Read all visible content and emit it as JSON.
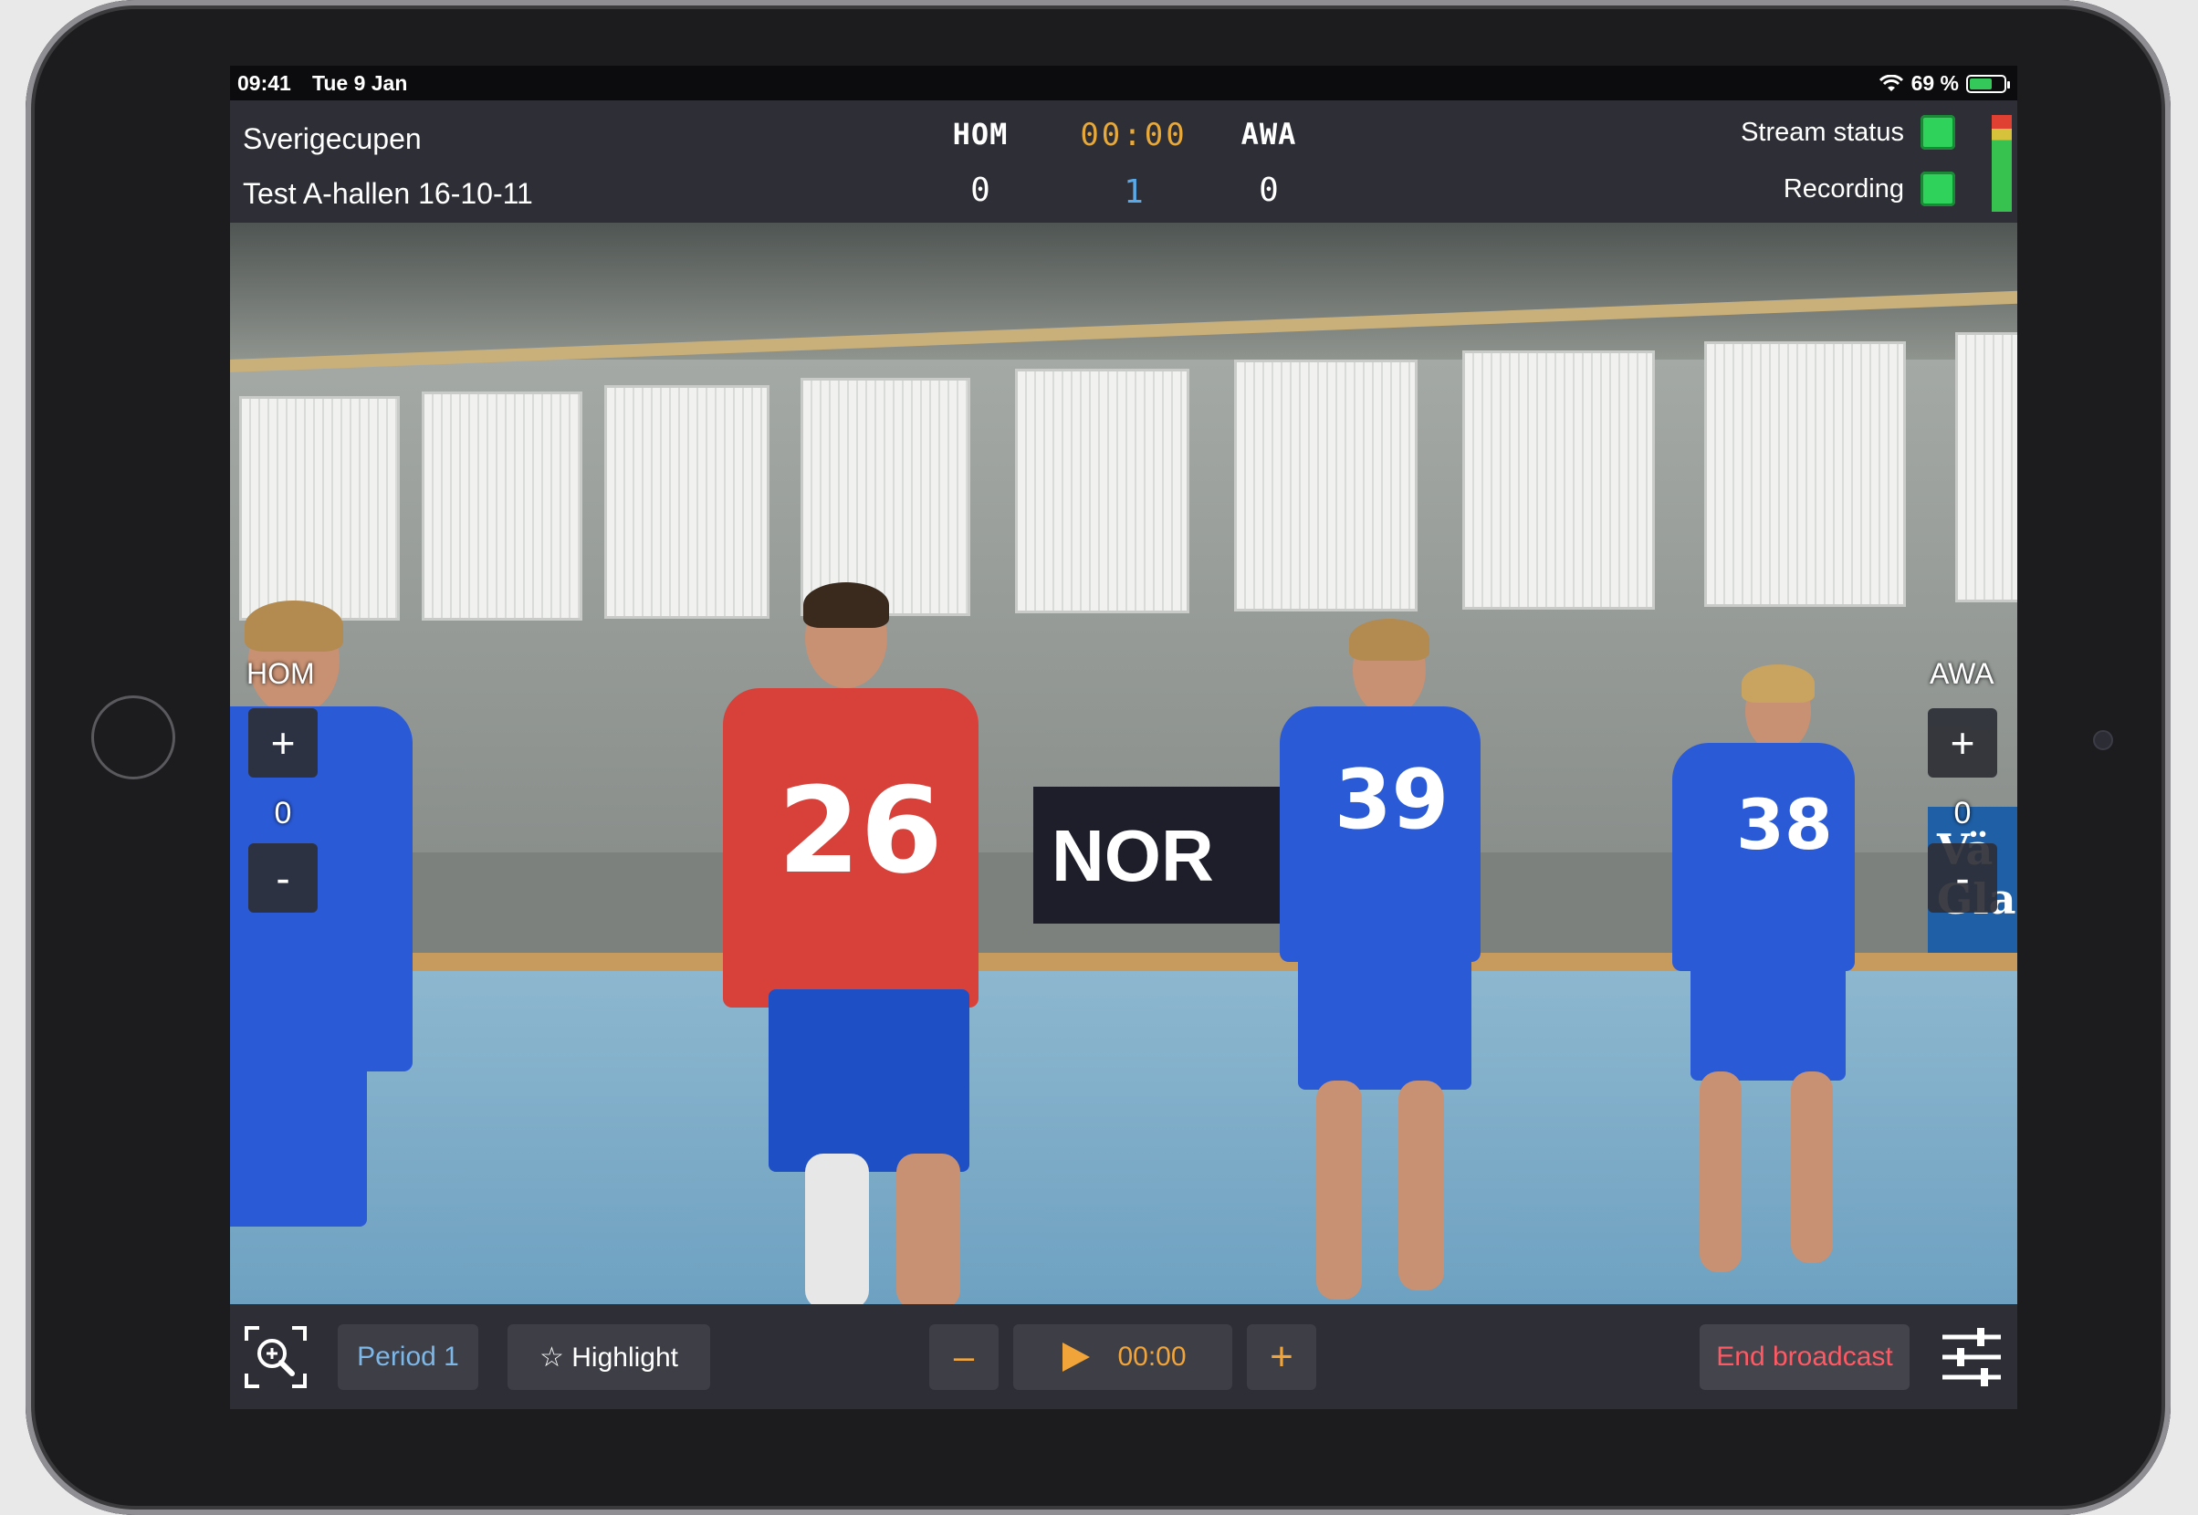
{
  "status_bar": {
    "time": "09:41",
    "date": "Tue 9 Jan",
    "battery": "69 %"
  },
  "scoreboard": {
    "event_name": "Sverigecupen",
    "event_subtitle": "Test A-hallen 16-10-11",
    "home_team": "HOM",
    "away_team": "AWA",
    "home_score": "0",
    "away_score": "0",
    "clock": "00:00",
    "period_number": "1",
    "stream_status_label": "Stream status",
    "recording_label": "Recording",
    "stream_status_color": "#2fd35b",
    "recording_color": "#2fd35b"
  },
  "overlay": {
    "home_label": "HOM",
    "away_label": "AWA",
    "home_score": "0",
    "away_score": "0",
    "plus": "+",
    "minus": "-"
  },
  "video": {
    "jersey_numbers": [
      "26",
      "39",
      "38"
    ],
    "banner_text": "NOR",
    "banner_right": "Vä Glas"
  },
  "toolbar": {
    "period_label": "Period 1",
    "highlight_label": "☆ Highlight",
    "minus": "–",
    "clock": "00:00",
    "plus": "+",
    "end_broadcast_label": "End broadcast",
    "accent_color": "#f0a43a",
    "period_color": "#7db7e8",
    "end_broadcast_color": "#ff5a64"
  }
}
